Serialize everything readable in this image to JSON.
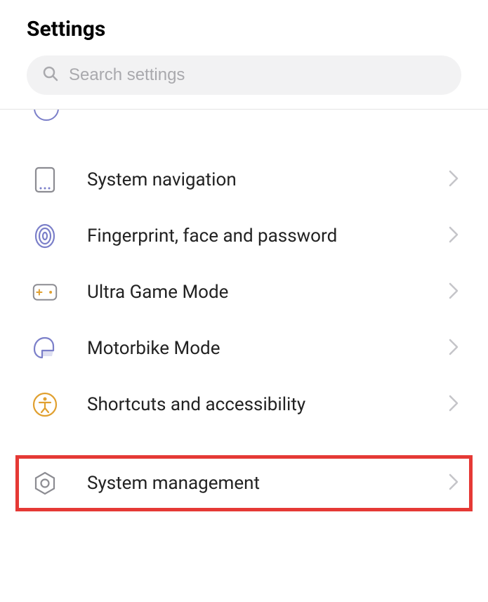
{
  "header": {
    "title": "Settings"
  },
  "search": {
    "placeholder": "Search settings"
  },
  "items": [
    {
      "label": "System navigation",
      "icon": "phone-nav",
      "highlighted": false
    },
    {
      "label": "Fingerprint, face and password",
      "icon": "fingerprint",
      "highlighted": false
    },
    {
      "label": "Ultra Game Mode",
      "icon": "gamepad",
      "highlighted": false
    },
    {
      "label": "Motorbike Mode",
      "icon": "helmet",
      "highlighted": false
    },
    {
      "label": "Shortcuts and accessibility",
      "icon": "accessibility",
      "highlighted": false
    },
    {
      "label": "System management",
      "icon": "gear-hex",
      "highlighted": true
    }
  ],
  "colors": {
    "purple": "#7b7fc9",
    "amber": "#e0a030",
    "gray": "#8c8c92",
    "highlight": "#e53935"
  }
}
